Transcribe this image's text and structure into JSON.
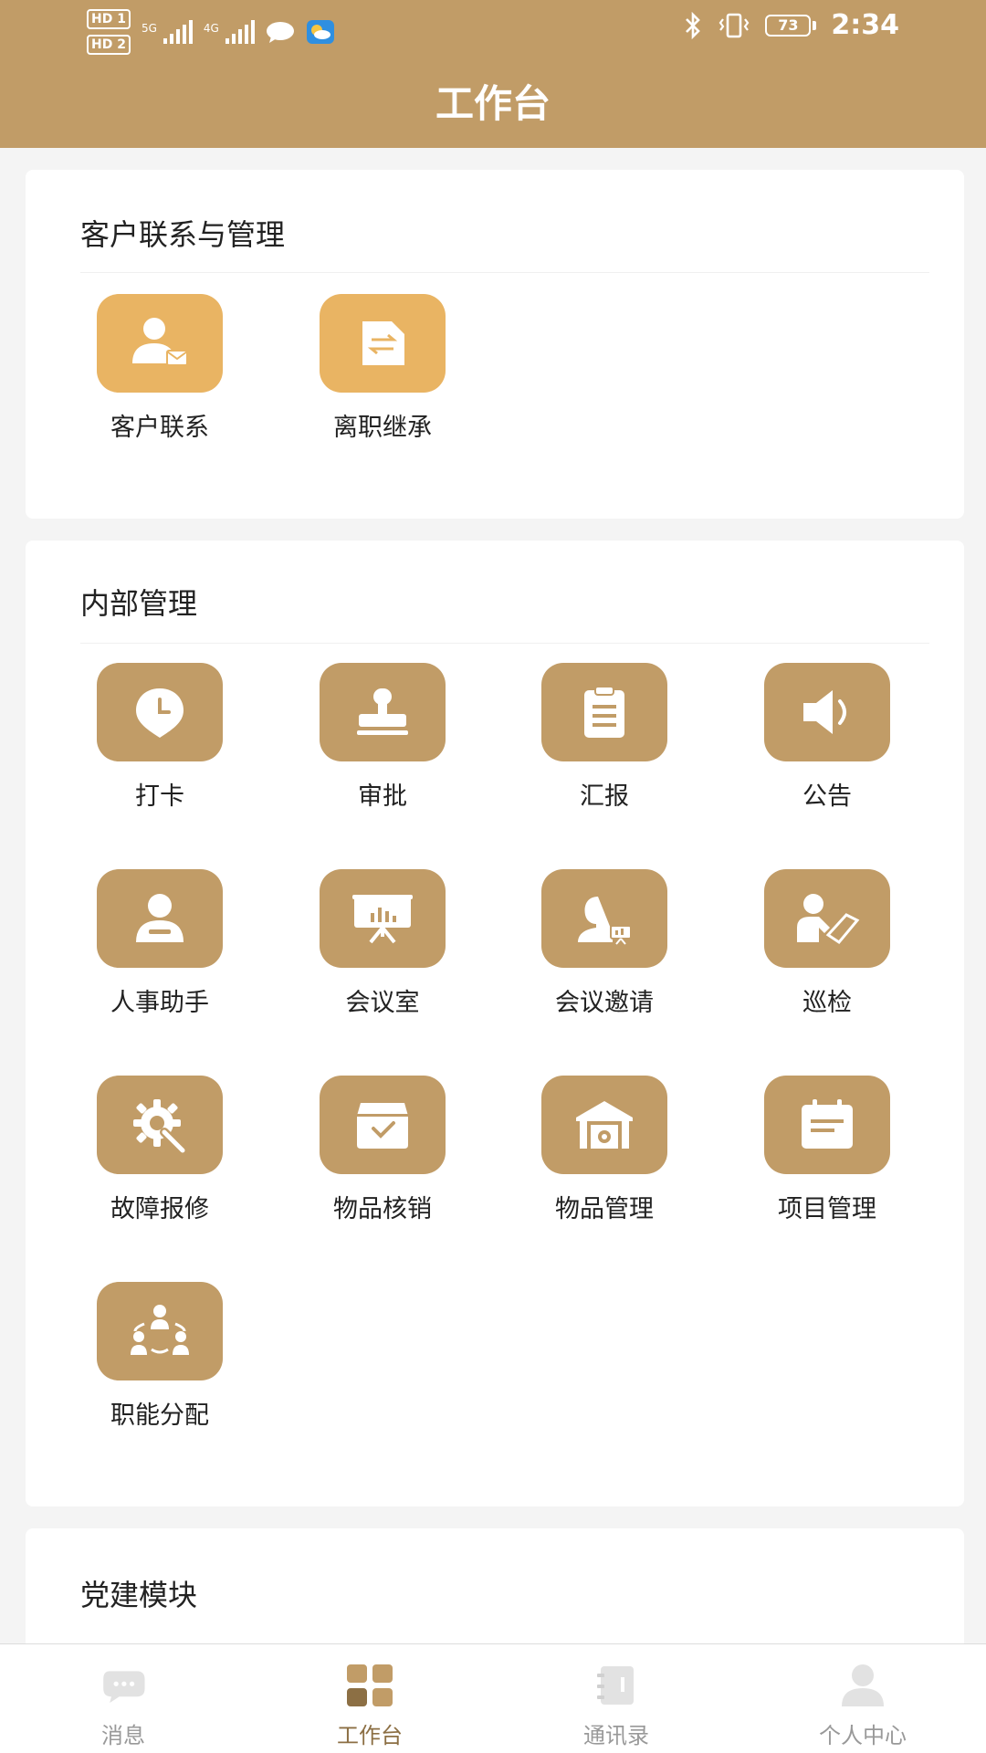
{
  "colors": {
    "header_bg": "#c19c67",
    "tile_gold": "#c19c67",
    "tile_light": "#e9b463",
    "active_nav": "#8c6f44",
    "inactive_nav": "#999999"
  },
  "status_bar": {
    "hd1": "HD 1",
    "hd2": "HD 2",
    "net1": "5G",
    "net2": "4G",
    "battery": "73",
    "time": "2:34"
  },
  "header": {
    "title": "工作台"
  },
  "sections": [
    {
      "title": "客户联系与管理",
      "items": [
        {
          "label": "客户联系",
          "icon": "customer-contact-icon"
        },
        {
          "label": "离职继承",
          "icon": "resignation-inherit-icon"
        }
      ]
    },
    {
      "title": "内部管理",
      "items": [
        {
          "label": "打卡",
          "icon": "clock-in-icon"
        },
        {
          "label": "审批",
          "icon": "approval-stamp-icon"
        },
        {
          "label": "汇报",
          "icon": "report-clipboard-icon"
        },
        {
          "label": "公告",
          "icon": "announcement-speaker-icon"
        },
        {
          "label": "人事助手",
          "icon": "hr-assistant-icon"
        },
        {
          "label": "会议室",
          "icon": "meeting-room-icon"
        },
        {
          "label": "会议邀请",
          "icon": "meeting-invite-icon"
        },
        {
          "label": "巡检",
          "icon": "inspection-icon"
        },
        {
          "label": "故障报修",
          "icon": "repair-gear-icon"
        },
        {
          "label": "物品核销",
          "icon": "item-writeoff-icon"
        },
        {
          "label": "物品管理",
          "icon": "warehouse-icon"
        },
        {
          "label": "项目管理",
          "icon": "project-calendar-icon"
        },
        {
          "label": "职能分配",
          "icon": "role-assign-icon"
        }
      ]
    },
    {
      "title": "党建模块",
      "items": []
    }
  ],
  "bottom_nav": [
    {
      "label": "消息",
      "icon": "message-icon",
      "active": false
    },
    {
      "label": "工作台",
      "icon": "workbench-icon",
      "active": true
    },
    {
      "label": "通讯录",
      "icon": "contacts-icon",
      "active": false
    },
    {
      "label": "个人中心",
      "icon": "profile-icon",
      "active": false
    }
  ]
}
